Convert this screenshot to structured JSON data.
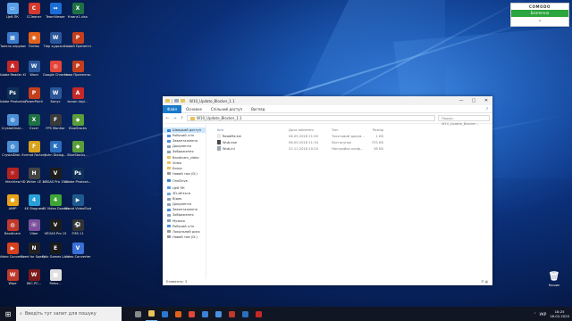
{
  "desktop": {
    "icons": [
      {
        "label": "Цей ПК",
        "color": "#5aa0e6",
        "glyph": "▭"
      },
      {
        "label": "CCleaner",
        "color": "#d23a2e",
        "glyph": "C"
      },
      {
        "label": "TeamViewer",
        "color": "#1a6dd6",
        "glyph": "↔"
      },
      {
        "label": "Книга1.xlsx",
        "color": "#1e7145",
        "glyph": "X"
      },
      {
        "label": "Панель керування",
        "color": "#3b7ac8",
        "glyph": "▦"
      },
      {
        "label": "Firefox",
        "color": "#e2621b",
        "glyph": "◉"
      },
      {
        "label": "Твір художн...",
        "color": "#2b579a",
        "glyph": "W"
      },
      {
        "label": "Новий Презентаці...",
        "color": "#c43e1c",
        "glyph": "P"
      },
      {
        "label": "Adobe Reader XI",
        "color": "#c62828",
        "glyph": "A"
      },
      {
        "label": "Word",
        "color": "#2b579a",
        "glyph": "W"
      },
      {
        "label": "Google Chrome",
        "color": "#e5463a",
        "glyph": "◎"
      },
      {
        "label": "Нова Презентаці...",
        "color": "#c43e1c",
        "glyph": "P"
      },
      {
        "label": "Adobe Photoshop",
        "color": "#0d2f58",
        "glyph": "Ps"
      },
      {
        "label": "PowerPoint",
        "color": "#c43e1c",
        "glyph": "P"
      },
      {
        "label": "Бонус",
        "color": "#2b579a",
        "glyph": "W"
      },
      {
        "label": "konan doyl...",
        "color": "#c62828",
        "glyph": "A"
      },
      {
        "label": "CrystalDiskI...",
        "color": "#4a8fd6",
        "glyph": "◍"
      },
      {
        "label": "Excel",
        "color": "#1e7145",
        "glyph": "X"
      },
      {
        "label": "FPS Monitor",
        "color": "#3a3a3a",
        "glyph": "F"
      },
      {
        "label": "BlueStacks",
        "color": "#5a9e3a",
        "glyph": "◆"
      },
      {
        "label": "CrystalDisk...",
        "color": "#4a8fd6",
        "glyph": "◍"
      },
      {
        "label": "Format Factory",
        "color": "#d9a21c",
        "glyph": "F"
      },
      {
        "label": "Kuhn Dialog...",
        "color": "#2a6fbf",
        "glyph": "K"
      },
      {
        "label": "BlueStacks...",
        "color": "#5a9e3a",
        "glyph": "◆"
      },
      {
        "label": "IrfanView",
        "color": "#b52222",
        "glyph": "☼"
      },
      {
        "label": "HD Writer LE 2.0",
        "color": "#444",
        "glyph": "H"
      },
      {
        "label": "VEGAS Pro 15.0",
        "color": "#1d1d1d",
        "glyph": "V"
      },
      {
        "label": "Adobe Photosh...",
        "color": "#0d2f58",
        "glyph": "Ps"
      },
      {
        "label": "AIMP",
        "color": "#e8a317",
        "glyph": "●"
      },
      {
        "label": "4K Stogram",
        "color": "#2aa0d8",
        "glyph": "4"
      },
      {
        "label": "4K Video Downloader",
        "color": "#3fa535",
        "glyph": "4"
      },
      {
        "label": "Wwod VideoStud...",
        "color": "#1f5a8e",
        "glyph": "▶"
      },
      {
        "label": "Bandicam",
        "color": "#c0392b",
        "glyph": "◍"
      },
      {
        "label": "Viber",
        "color": "#7b519d",
        "glyph": "☏"
      },
      {
        "label": "VEGAS Pro 15",
        "color": "#1d1d1d",
        "glyph": "V"
      },
      {
        "label": "FIFA 11",
        "color": "#333",
        "glyph": "⚽"
      },
      {
        "label": "Video Convert...",
        "color": "#d9401e",
        "glyph": "▶"
      },
      {
        "label": "Need for Speed ...",
        "color": "#222",
        "glyph": "N"
      },
      {
        "label": "Epic Games Launcher",
        "color": "#1a1a1a",
        "glyph": "E"
      },
      {
        "label": "Video Converter",
        "color": "#3a6fd8",
        "glyph": "V"
      },
      {
        "label": "Wipe",
        "color": "#c0392b",
        "glyph": "W"
      },
      {
        "label": "WiC-PC...",
        "color": "#7a1a1a",
        "glyph": "W"
      },
      {
        "label": "Pafus...",
        "color": "#e0e0e0",
        "glyph": "■"
      }
    ],
    "recycle_bin": {
      "label": "Кошик"
    }
  },
  "comodo": {
    "brand": "COMODO",
    "state": "Безпечно",
    "chevron": "⌄"
  },
  "window": {
    "title": "W10_Update_Blocker_1.1",
    "controls": {
      "min": "—",
      "max": "▢",
      "close": "✕"
    },
    "ribbon_tabs": [
      "Файл",
      "Основне",
      "Спільний доступ",
      "Вигляд"
    ],
    "help": "?",
    "nav": {
      "back": "←",
      "forward": "→",
      "up": "↑"
    },
    "path": [
      "W10_Update_Blocker_1.1"
    ],
    "search_placeholder": "Пошук: W10_Update_Blocker...",
    "nav_pane": [
      {
        "label": "Швидкий доступ",
        "color": "#3b82d6",
        "sel": true
      },
      {
        "label": "Робочий стіл",
        "color": "#4a90e2"
      },
      {
        "label": "Завантаження",
        "color": "#4a90e2"
      },
      {
        "label": "Документи",
        "color": "#8aa1b5"
      },
      {
        "label": "Зображення",
        "color": "#8aa1b5"
      },
      {
        "label": "Bandicam_video",
        "color": "#e8c25a"
      },
      {
        "label": "Video",
        "color": "#e8c25a"
      },
      {
        "label": "Бонус",
        "color": "#e8c25a"
      },
      {
        "label": "Новий том (D:)",
        "color": "#999"
      },
      {
        "label": "OneDrive",
        "color": "#3b82d6",
        "gap": true
      },
      {
        "label": "Цей ПК",
        "color": "#5aa0e6",
        "gap": true
      },
      {
        "label": "3D-об'єкти",
        "color": "#6fa8dc"
      },
      {
        "label": "Відео",
        "color": "#8aa1b5"
      },
      {
        "label": "Документи",
        "color": "#8aa1b5"
      },
      {
        "label": "Завантаження",
        "color": "#4a90e2"
      },
      {
        "label": "Зображення",
        "color": "#8aa1b5"
      },
      {
        "label": "Музика",
        "color": "#8aa1b5"
      },
      {
        "label": "Робочий стіл",
        "color": "#4a90e2"
      },
      {
        "label": "Локальний диск",
        "color": "#999"
      },
      {
        "label": "Новий том (D:)",
        "color": "#999"
      }
    ],
    "columns": {
      "name": "Ім'я",
      "date": "Дата змінення",
      "type": "Тип",
      "size": "Розмір"
    },
    "files": [
      {
        "name": "ReadMe.txt",
        "date": "06.05.2018 21:00",
        "type": "Текстовий докум...",
        "size": "1 КБ",
        "color": "#e8e8e8"
      },
      {
        "name": "Wub.exe",
        "date": "06.05.2018 21:34",
        "type": "Застосунок",
        "size": "725 КБ",
        "color": "#4a4a4a"
      },
      {
        "name": "Wub.ini",
        "date": "22.11.2018 20:20",
        "type": "Настройки конф...",
        "size": "38 КБ",
        "color": "#9aa7b5"
      }
    ],
    "status": "Елементи: 3",
    "views": "☰ ▦"
  },
  "taskbar": {
    "start": "⊞",
    "search_icon": "⌕",
    "search_placeholder": "Введіть тут запит для пошуку",
    "apps": [
      {
        "name": "task-view",
        "color": "#8a8a8a"
      },
      {
        "name": "explorer",
        "color": "#e8c25a",
        "on": true
      },
      {
        "name": "edge",
        "color": "#2b78d6"
      },
      {
        "name": "firefox",
        "color": "#e2621b"
      },
      {
        "name": "chrome",
        "color": "#e5463a"
      },
      {
        "name": "store",
        "color": "#3b82d6"
      },
      {
        "name": "mail",
        "color": "#4a90e2"
      },
      {
        "name": "bandicam",
        "color": "#c0392b"
      },
      {
        "name": "photos",
        "color": "#2a6fbf"
      },
      {
        "name": "screenshot",
        "color": "#c62828"
      }
    ],
    "tray": {
      "arrows": "˄",
      "lang": "УКР",
      "time": "18:25",
      "date": "16.02.2020"
    }
  }
}
